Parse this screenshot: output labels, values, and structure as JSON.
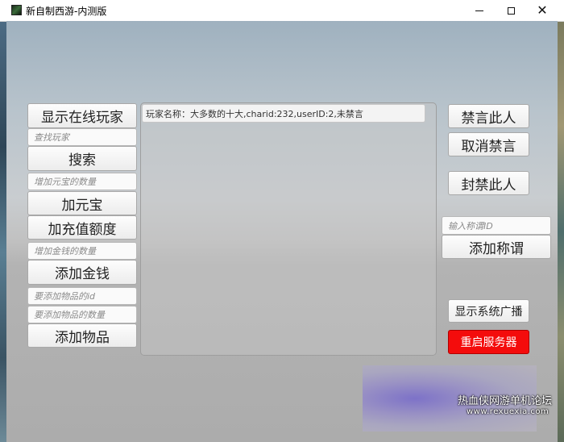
{
  "window": {
    "title": "新自制西游-内测版",
    "controls": {
      "minimize_icon": "minimize-icon",
      "maximize_icon": "maximize-icon",
      "close_icon": "close-icon",
      "close_glyph": "✕"
    }
  },
  "left_panel": {
    "show_online_players": "显示在线玩家",
    "find_player_placeholder": "查找玩家",
    "search": "搜索",
    "add_yuanbao_placeholder": "增加元宝的数量",
    "add_yuanbao": "加元宝",
    "add_recharge_amount": "加充值额度",
    "add_money_placeholder": "增加金钱的数量",
    "add_money": "添加金钱",
    "item_id_placeholder": "要添加物品的id",
    "item_count_placeholder": "要添加物品的数量",
    "add_item": "添加物品"
  },
  "player_list": [
    {
      "text": "玩家名称：大多数的十大,charid:232,userID:2,未禁言"
    }
  ],
  "right_panel": {
    "mute_player": "禁言此人",
    "unmute": "取消禁言",
    "ban_player": "封禁此人",
    "title_placeholder": "输入称谓ID",
    "add_title": "添加称谓",
    "show_broadcast": "显示系统广播",
    "restart_server": "重启服务器"
  },
  "colors": {
    "restart_button": "#f40c0c"
  },
  "watermark": {
    "line1": "热血侠网游单机论坛",
    "line2": "www.rexuexia.com"
  }
}
